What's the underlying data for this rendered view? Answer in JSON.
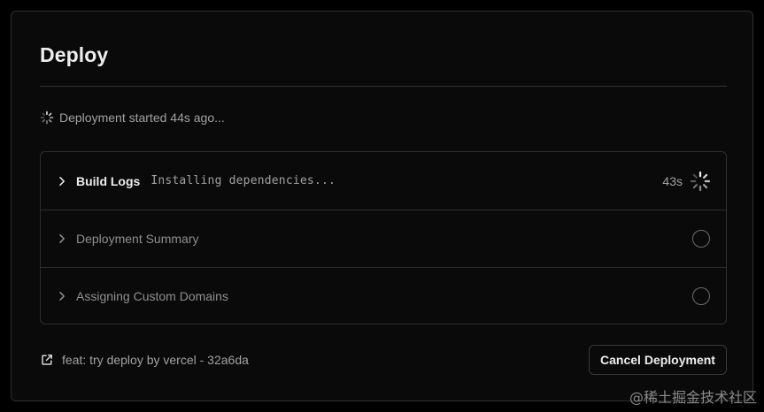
{
  "deploy": {
    "title": "Deploy",
    "status_text": "Deployment started 44s ago...",
    "steps": [
      {
        "label": "Build Logs",
        "log": "Installing dependencies...",
        "duration": "43s",
        "state": "running",
        "icon": "spinner-icon"
      },
      {
        "label": "Deployment Summary",
        "state": "pending",
        "icon": "pending-circle-icon"
      },
      {
        "label": "Assigning Custom Domains",
        "state": "pending",
        "icon": "pending-circle-icon"
      }
    ],
    "commit": {
      "icon": "external-link-icon",
      "text": "feat: try deploy by vercel - 32a6da"
    },
    "cancel_label": "Cancel Deployment"
  },
  "watermark": "@稀土掘金技术社区",
  "colors": {
    "background": "#0a0a0a",
    "border": "#2e2e2e",
    "text_primary": "#ededed",
    "text_secondary": "#a1a1a1",
    "text_muted": "#8f8f8f"
  }
}
